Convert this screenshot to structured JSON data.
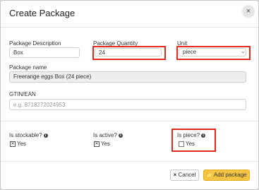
{
  "modal": {
    "title": "Create Package",
    "close_icon": "×"
  },
  "description": {
    "label": "Package Description",
    "value": "Box"
  },
  "quantity": {
    "label": "Package Quantity",
    "value": "24"
  },
  "unit": {
    "label": "Unit",
    "value": "piece",
    "arrow": "⌄"
  },
  "package_name": {
    "label": "Package name",
    "value": "Freerange eggs Box (24 piece)"
  },
  "gtin": {
    "label": "GTIN/EAN",
    "placeholder": "e.g. 8718272024953"
  },
  "stockable": {
    "label": "Is stockable?",
    "checked": true,
    "option": "Yes",
    "info_icon": "i"
  },
  "active": {
    "label": "Is active?",
    "checked": true,
    "option": "Yes",
    "info_icon": "i"
  },
  "piece": {
    "label": "Is piece?",
    "checked": false,
    "option": "Yes",
    "info_icon": "i"
  },
  "footer": {
    "cancel_label": "Cancel",
    "cancel_icon": "×",
    "add_label": "Add package",
    "add_icon": "📁"
  },
  "colors": {
    "highlight": "#e02a1c",
    "primary_button": "#f4c542"
  }
}
